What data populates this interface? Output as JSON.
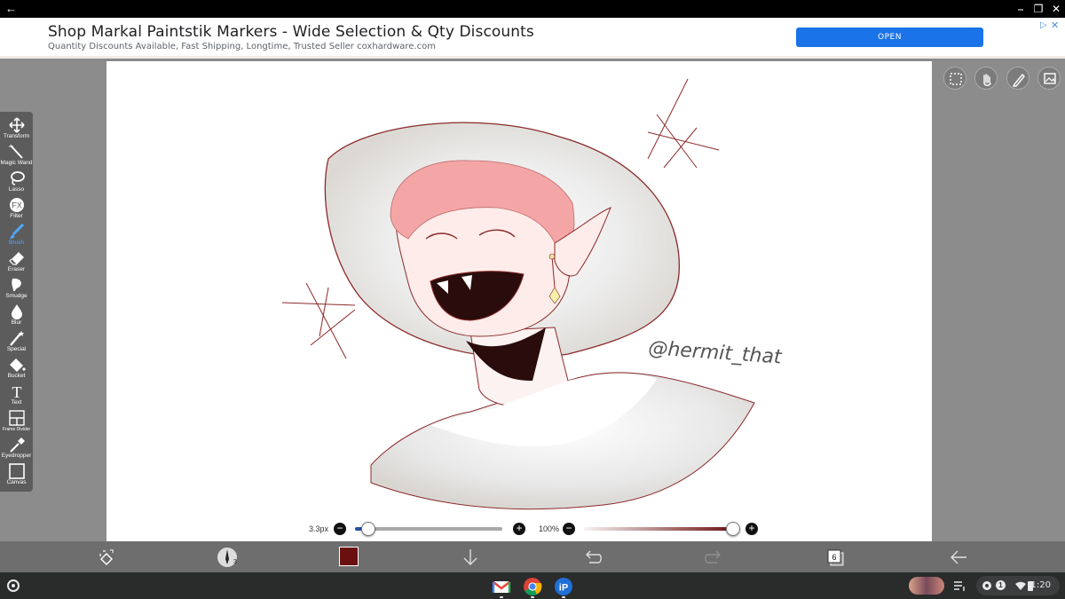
{
  "titlebar": {
    "back_label": "←",
    "minimize_label": "⎯",
    "restore_label": "❐",
    "close_label": "✕"
  },
  "ad": {
    "title": "Shop Markal Paintstik Markers - Wide Selection & Qty Discounts",
    "subtitle": "Quantity Discounts Available, Fast Shipping, Longtime, Trusted Seller coxhardware.com",
    "button_label": "OPEN",
    "choices_icon": "ad-choices-icon",
    "close_label": "✕"
  },
  "tools": [
    {
      "label": "Transform",
      "icon": "transform-icon"
    },
    {
      "label": "Magic Wand",
      "icon": "magic-wand-icon"
    },
    {
      "label": "Lasso",
      "icon": "lasso-icon"
    },
    {
      "label": "Filter",
      "icon": "filter-icon",
      "glyph": "FX"
    },
    {
      "label": "Brush",
      "icon": "brush-icon",
      "active": true
    },
    {
      "label": "Eraser",
      "icon": "eraser-icon"
    },
    {
      "label": "Smudge",
      "icon": "smudge-icon"
    },
    {
      "label": "Blur",
      "icon": "blur-icon"
    },
    {
      "label": "Special",
      "icon": "special-icon"
    },
    {
      "label": "Bucket",
      "icon": "bucket-icon"
    },
    {
      "label": "Text",
      "icon": "text-icon",
      "glyph": "T"
    },
    {
      "label": "Frame Divider",
      "icon": "frame-divider-icon"
    },
    {
      "label": "Eyedropper",
      "icon": "eyedropper-icon"
    },
    {
      "label": "Canvas",
      "icon": "canvas-icon"
    }
  ],
  "right_tools": [
    "selection-icon",
    "hand-icon",
    "pen-icon",
    "reference-icon"
  ],
  "brush_size": {
    "value_label": "3.3px",
    "minus": "−",
    "plus": "+",
    "level": 0.04
  },
  "opacity": {
    "value_label": "100%",
    "minus": "−",
    "plus": "+",
    "level": 1.0
  },
  "bottombar": {
    "brush_number": "3",
    "color": "#6b1010",
    "layers_count": "6"
  },
  "artwork": {
    "signature": "@hermit_that",
    "line_color": "#8b2a2a",
    "hair_color": "#f4a6a6",
    "hat_color": "#e6e3de"
  },
  "shelf": {
    "apps": [
      "gmail-icon",
      "chrome-icon",
      "ibispaint-icon"
    ],
    "notification_count": "1",
    "clock": "1:20"
  }
}
